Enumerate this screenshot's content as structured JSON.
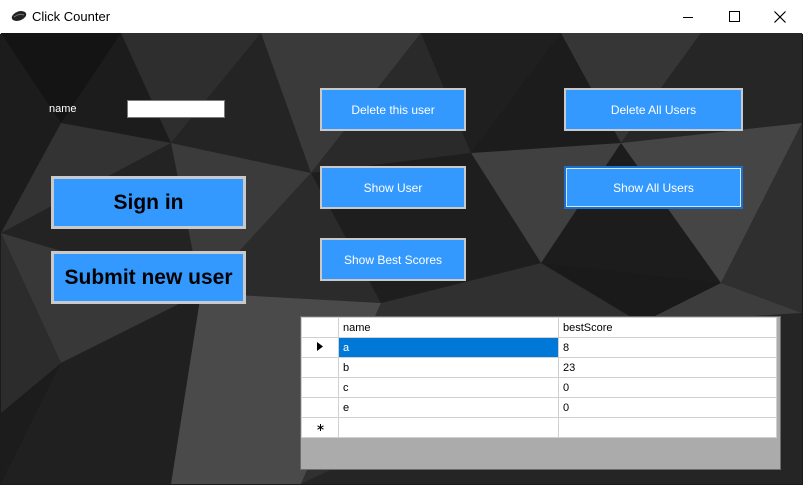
{
  "window": {
    "title": "Click Counter"
  },
  "form": {
    "name_label": "name",
    "name_value": "",
    "buttons": {
      "sign_in": "Sign in",
      "submit_new_user": "Submit new user",
      "delete_this_user": "Delete this user",
      "show_user": "Show User",
      "show_best_scores": "Show Best Scores",
      "delete_all_users": "Delete All Users",
      "show_all_users": "Show All Users"
    }
  },
  "grid": {
    "columns": [
      "name",
      "bestScore"
    ],
    "rows": [
      {
        "name": "a",
        "bestScore": "8"
      },
      {
        "name": "b",
        "bestScore": "23"
      },
      {
        "name": "c",
        "bestScore": "0"
      },
      {
        "name": "e",
        "bestScore": "0"
      }
    ],
    "selected_row": 0
  },
  "colors": {
    "button": "#3399ff",
    "selection": "#0078d7"
  }
}
